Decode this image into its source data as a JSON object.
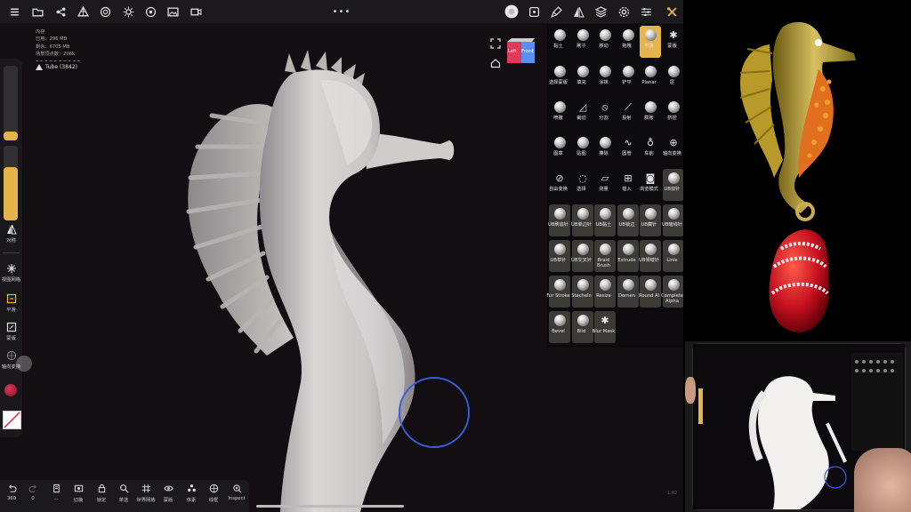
{
  "topbar": {
    "left_icons": [
      "folder-icon",
      "share-icon",
      "mesh-icon",
      "sphere-icon",
      "sun-icon",
      "camera-icon",
      "image-icon",
      "video-icon"
    ],
    "center_menu": "•••",
    "right_icons": [
      "brush-preview-icon",
      "stroke-icon",
      "paint-icon",
      "symmetry-icon",
      "layers-icon",
      "settings-icon",
      "sliders-icon",
      "tools-icon"
    ]
  },
  "stats": {
    "lines": [
      "内存",
      "已用：296 MB",
      "剩余：6705 MB",
      "场景顶点数：206k"
    ],
    "mesh_name": "Tube (3842)"
  },
  "viewcube": {
    "left_label": "Left",
    "front_label": "Front"
  },
  "left_rail": {
    "radius_fill": 0.12,
    "intensity_fill": 0.72,
    "symmetry_label": "对称",
    "tools": [
      {
        "label": "视图网格",
        "icon": "grid-view-icon"
      },
      {
        "label": "平滑",
        "icon": "smooth-icon"
      },
      {
        "label": "蒙版",
        "icon": "mask-icon"
      },
      {
        "label": "轴向变换",
        "icon": "axis-transform-icon"
      }
    ]
  },
  "tools": {
    "rows": [
      [
        {
          "label": "黏土"
        },
        {
          "label": "刷子"
        },
        {
          "label": "移动"
        },
        {
          "label": "拖拽"
        },
        {
          "label": "平滑",
          "active": true
        },
        {
          "label": "蒙版",
          "glyph": "✱"
        }
      ],
      [
        {
          "label": "选择蒙版"
        },
        {
          "label": "填充"
        },
        {
          "label": "涂抹"
        },
        {
          "label": "铲平"
        },
        {
          "label": "Planar"
        },
        {
          "label": "层"
        }
      ],
      [
        {
          "label": "喷撒"
        },
        {
          "label": "裁切",
          "glyph": "◿"
        },
        {
          "label": "分割",
          "glyph": "⦸"
        },
        {
          "label": "投射",
          "glyph": "⟋"
        },
        {
          "label": "膨胀"
        },
        {
          "label": "挤捏"
        }
      ],
      [
        {
          "label": "图章"
        },
        {
          "label": "贴图"
        },
        {
          "label": "擦除"
        },
        {
          "label": "圆管",
          "glyph": "∿"
        },
        {
          "label": "车削",
          "glyph": "♁"
        },
        {
          "label": "轴向变换",
          "glyph": "⊕"
        }
      ],
      [
        {
          "label": "自由变换",
          "glyph": "⊘"
        },
        {
          "label": "选择",
          "glyph": "◌"
        },
        {
          "label": "测量",
          "glyph": "▱"
        },
        {
          "label": "插入",
          "glyph": "⊞"
        },
        {
          "label": "浏览模式",
          "glyph": "◙"
        },
        {
          "label": "UB双针",
          "boxed": true
        }
      ],
      [
        {
          "label": "UB刷造针",
          "boxed": true
        },
        {
          "label": "UB单边针",
          "boxed": true
        },
        {
          "label": "UB黏土",
          "boxed": true
        },
        {
          "label": "UB锁边",
          "boxed": true
        },
        {
          "label": "UB藏针",
          "boxed": true
        },
        {
          "label": "UB暗线针",
          "boxed": true
        }
      ],
      [
        {
          "label": "UB草针",
          "boxed": true
        },
        {
          "label": "UB交叉针",
          "boxed": true
        },
        {
          "label": "Braid Brush",
          "boxed": true
        },
        {
          "label": "Extrude",
          "boxed": true
        },
        {
          "label": "UB倾缝针",
          "boxed": true
        },
        {
          "label": "Linie",
          "boxed": true
        }
      ],
      [
        {
          "label": "Fur Stroke",
          "boxed": true
        },
        {
          "label": "Stacheln",
          "boxed": true
        },
        {
          "label": "Resize",
          "boxed": true
        },
        {
          "label": "Dornen",
          "boxed": true
        },
        {
          "label": "Round Al",
          "boxed": true
        },
        {
          "label": "Complete Alpha",
          "boxed": true
        }
      ],
      [
        {
          "label": "Bevel",
          "boxed": true
        },
        {
          "label": "Bild",
          "boxed": true
        },
        {
          "label": "Blur Mask",
          "boxed": true,
          "glyph": "✱"
        }
      ]
    ]
  },
  "bottombar": [
    {
      "label": "360",
      "icon": "undo-icon"
    },
    {
      "label": "0",
      "icon": "redo-icon"
    },
    {
      "label": "...",
      "icon": "file-icon"
    },
    {
      "label": "切换",
      "icon": "switch-icon"
    },
    {
      "label": "锁定",
      "icon": "lock-icon"
    },
    {
      "label": "单选",
      "icon": "search-icon"
    },
    {
      "label": "世界网格",
      "icon": "world-grid-icon"
    },
    {
      "label": "蒙版",
      "icon": "eye-icon"
    },
    {
      "label": "体素",
      "icon": "voxel-icon"
    },
    {
      "label": "线框",
      "icon": "wireframe-icon"
    },
    {
      "label": "Inspect",
      "icon": "inspect-icon"
    }
  ],
  "overlay": {
    "fps_label": "1.82"
  },
  "colors": {
    "accent": "#e6b44e",
    "panel_bg": "#1b191c",
    "viewport_bg": "#120e12",
    "brush_cursor": "#3b5bd8",
    "cube_red": "#e0395a",
    "cube_blue": "#5a8ff0"
  }
}
